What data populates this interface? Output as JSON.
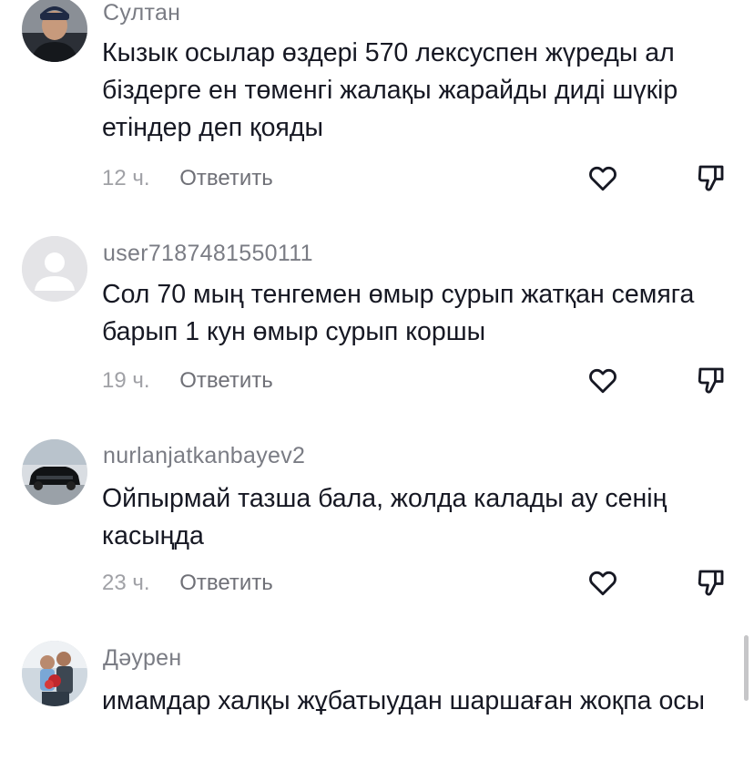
{
  "comments": [
    {
      "username": "Султан",
      "text": "Кызык осылар өздері 570 лексуспен жүреды ал біздерге ен төменгі жалақы жарайды диді шүкір етіндер деп қояды",
      "time": "12 ч.",
      "reply_label": "Ответить",
      "avatar": "man-portrait-avatar"
    },
    {
      "username": "user7187481550111",
      "text": "Сол 70 мың тенгемен өмыр сурып жатқан семяга барып 1 кун өмыр сурып коршы",
      "time": "19 ч.",
      "reply_label": "Ответить",
      "avatar": "default-user-avatar"
    },
    {
      "username": "nurlanjatkanbayev2",
      "text": "Ойпырмай тазша бала, жолда калады ау сенің касыңда",
      "time": "23 ч.",
      "reply_label": "Ответить",
      "avatar": "black-suv-avatar"
    },
    {
      "username": "Дәурен",
      "text": "имамдар халқы жұбатыудан шаршаған жоқпа осы",
      "avatar": "family-photo-avatar"
    }
  ],
  "colors": {
    "text": "#161823",
    "secondary": "#7a7c84",
    "icon": "#161823"
  }
}
